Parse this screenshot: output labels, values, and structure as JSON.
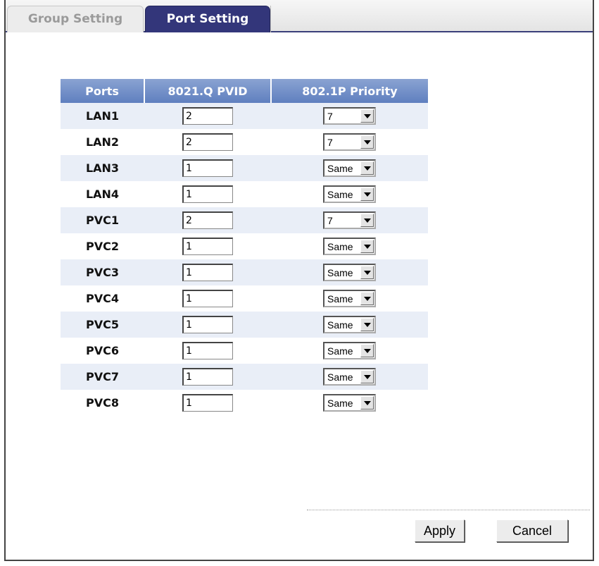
{
  "tabs": [
    {
      "label": "Group Setting",
      "active": false
    },
    {
      "label": "Port Setting",
      "active": true
    }
  ],
  "table": {
    "headers": [
      "Ports",
      "8021.Q PVID",
      "802.1P Priority"
    ],
    "rows": [
      {
        "port": "LAN1",
        "pvid": "2",
        "priority": "7"
      },
      {
        "port": "LAN2",
        "pvid": "2",
        "priority": "7"
      },
      {
        "port": "LAN3",
        "pvid": "1",
        "priority": "Same"
      },
      {
        "port": "LAN4",
        "pvid": "1",
        "priority": "Same"
      },
      {
        "port": "PVC1",
        "pvid": "2",
        "priority": "7"
      },
      {
        "port": "PVC2",
        "pvid": "1",
        "priority": "Same"
      },
      {
        "port": "PVC3",
        "pvid": "1",
        "priority": "Same"
      },
      {
        "port": "PVC4",
        "pvid": "1",
        "priority": "Same"
      },
      {
        "port": "PVC5",
        "pvid": "1",
        "priority": "Same"
      },
      {
        "port": "PVC6",
        "pvid": "1",
        "priority": "Same"
      },
      {
        "port": "PVC7",
        "pvid": "1",
        "priority": "Same"
      },
      {
        "port": "PVC8",
        "pvid": "1",
        "priority": "Same"
      }
    ]
  },
  "buttons": {
    "apply": "Apply",
    "cancel": "Cancel"
  },
  "colors": {
    "tab_active": "#33367a",
    "header": "#6f8cc8",
    "row_shade": "#e9eef7"
  }
}
